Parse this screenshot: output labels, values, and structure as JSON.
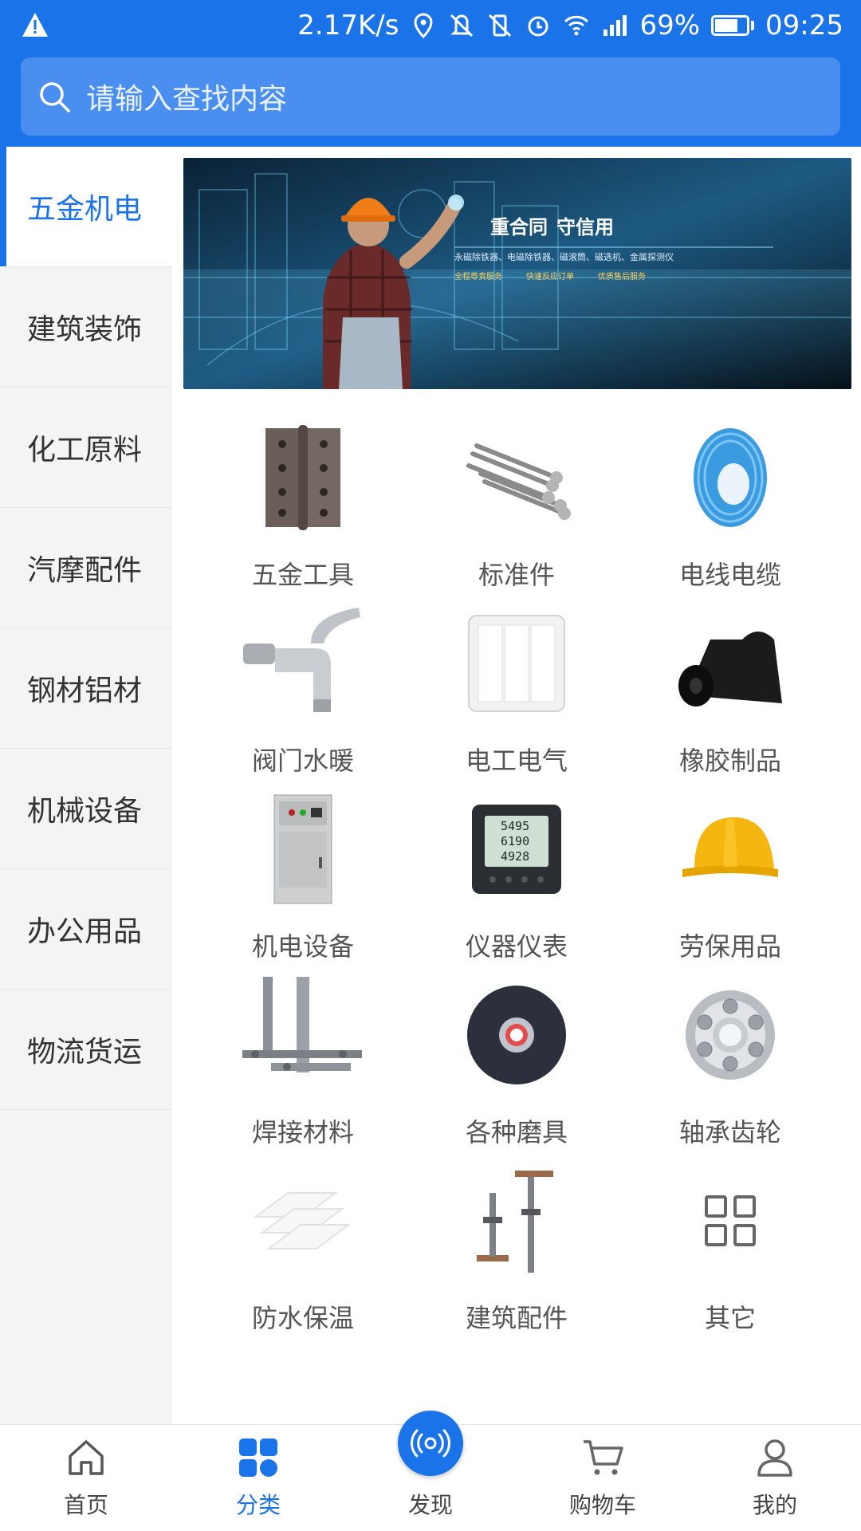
{
  "status_bar": {
    "speed": "2.17K/s",
    "battery": "69%",
    "battery_level": 0.69,
    "time": "09:25"
  },
  "search": {
    "placeholder": "请输入查找内容"
  },
  "sidebar": {
    "items": [
      {
        "label": "五金机电",
        "active": true
      },
      {
        "label": "建筑装饰"
      },
      {
        "label": "化工原料"
      },
      {
        "label": "汽摩配件"
      },
      {
        "label": "钢材铝材"
      },
      {
        "label": "机械设备"
      },
      {
        "label": "办公用品"
      },
      {
        "label": "物流货运"
      }
    ]
  },
  "banner": {
    "headline_1": "重合同",
    "headline_2": "守信用",
    "subline": "永磁除铁器、电磁除铁器、磁滚筒、磁选机、金属探测仪",
    "features": [
      "全程尊贵服务",
      "快速反应订单",
      "优质售后服务"
    ]
  },
  "categories": [
    {
      "label": "五金工具",
      "icon": "door-hinge-icon"
    },
    {
      "label": "标准件",
      "icon": "screws-icon"
    },
    {
      "label": "电线电缆",
      "icon": "wire-coil-icon"
    },
    {
      "label": "阀门水暖",
      "icon": "water-faucet-icon"
    },
    {
      "label": "电工电气",
      "icon": "light-switch-icon"
    },
    {
      "label": "橡胶制品",
      "icon": "rubber-roll-icon"
    },
    {
      "label": "机电设备",
      "icon": "switch-cabinet-icon"
    },
    {
      "label": "仪器仪表",
      "icon": "digital-meter-icon"
    },
    {
      "label": "劳保用品",
      "icon": "hard-hat-icon"
    },
    {
      "label": "焊接材料",
      "icon": "steel-bracket-icon"
    },
    {
      "label": "各种磨具",
      "icon": "grinding-disc-icon"
    },
    {
      "label": "轴承齿轮",
      "icon": "ball-bearing-icon"
    },
    {
      "label": "防水保温",
      "icon": "insulation-board-icon"
    },
    {
      "label": "建筑配件",
      "icon": "scaffold-jack-icon"
    },
    {
      "label": "其它",
      "icon": "grid-apps-icon"
    }
  ],
  "meter_readings": [
    "5495",
    "6190",
    "4928"
  ],
  "bottom_nav": {
    "items": [
      {
        "label": "首页",
        "icon": "home-icon"
      },
      {
        "label": "分类",
        "icon": "category-icon",
        "active": true
      },
      {
        "label": "发现",
        "icon": "discover-icon"
      },
      {
        "label": "购物车",
        "icon": "cart-icon"
      },
      {
        "label": "我的",
        "icon": "profile-icon"
      }
    ]
  },
  "colors": {
    "primary": "#1a73e8",
    "sidebar_bg": "#f4f4f4"
  }
}
